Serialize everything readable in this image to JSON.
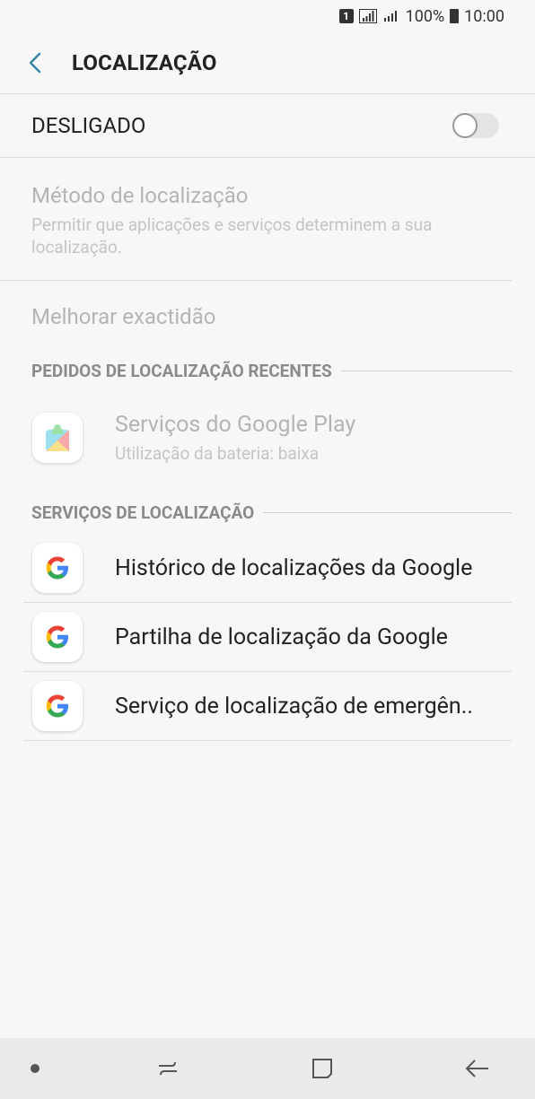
{
  "status_bar": {
    "sim": "1",
    "battery": "100%",
    "time": "10:00"
  },
  "header": {
    "title": "LOCALIZAÇÃO",
    "back_icon": "chevron-left-icon"
  },
  "master_toggle": {
    "label": "DESLIGADO",
    "state": "off"
  },
  "settings": {
    "method": {
      "title": "Método de localização",
      "subtitle": "Permitir que aplicações e serviços determinem a sua localização."
    },
    "accuracy": {
      "title": "Melhorar exactidão"
    }
  },
  "recent_requests": {
    "header": "PEDIDOS DE LOCALIZAÇÃO RECENTES",
    "items": [
      {
        "title": "Serviços do Google Play",
        "subtitle": "Utilização da bateria: baixa",
        "icon": "google-play-services-icon"
      }
    ]
  },
  "location_services": {
    "header": "SERVIÇOS DE LOCALIZAÇÃO",
    "items": [
      {
        "title": "Histórico de localizações da Google",
        "icon": "google-g-icon"
      },
      {
        "title": "Partilha de localização da Google",
        "icon": "google-g-icon"
      },
      {
        "title": "Serviço de localização de emergên..",
        "icon": "google-g-icon"
      }
    ]
  },
  "nav_bar": {
    "icons": [
      "dot-icon",
      "recents-icon",
      "home-icon",
      "back-arrow-icon"
    ]
  },
  "colors": {
    "background": "#f7f7f7",
    "accent": "#3b86a4",
    "disabled_text": "#b4b4b4"
  }
}
